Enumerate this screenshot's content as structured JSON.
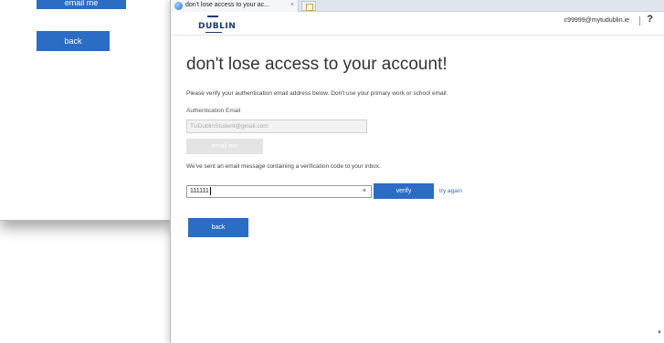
{
  "background_window": {
    "email_button_label": "email me",
    "back_label": "back"
  },
  "browser": {
    "tab_title": "don't lose access to your ac...",
    "tab_close": "×"
  },
  "header": {
    "logo_text": "DUBLIN",
    "user_email": "c99999@mytudublin.ie",
    "help_glyph": "?"
  },
  "main": {
    "title": "don't lose access to your account!",
    "instruction": "Please verify your authentication email address below. Don't use your primary work or school email.",
    "email_label": "Authentication Email",
    "email_value": "TUDublinStudent@gmail.com",
    "email_me_label": "email me",
    "sent_message": "We've sent an email message containing a verification code to your inbox.",
    "code_value": "111111",
    "clear_glyph": "×",
    "verify_label": "verify",
    "try_again_label": "try again",
    "back_label": "back"
  },
  "colors": {
    "accent": "#2b6cc4",
    "disabled_button": "#e4e4e4",
    "logo": "#1c3a6e"
  }
}
